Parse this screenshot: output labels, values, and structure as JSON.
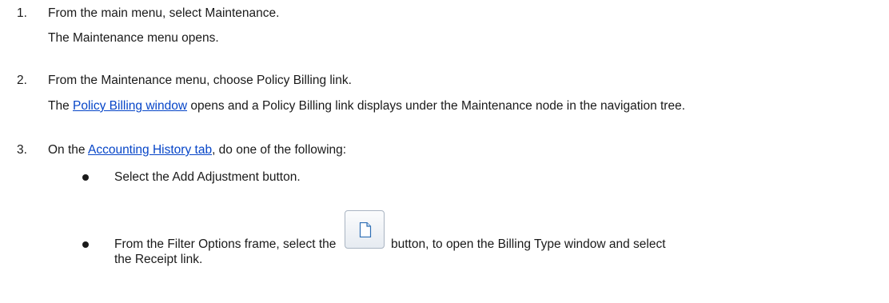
{
  "steps": [
    {
      "number": "1.",
      "lines": [
        "From the main menu, select Maintenance.",
        "The Maintenance menu opens."
      ]
    },
    {
      "number": "2.",
      "line1": "From the Maintenance menu, choose Policy Billing link.",
      "line2_link": "Policy Billing window",
      "line2_before": "The ",
      "line2_after": " opens and a Policy Billing link displays under the Maintenance node in the navigation tree."
    },
    {
      "number": "3.",
      "before": "On the ",
      "link": "Accounting History tab",
      "after": ", do one of the following:",
      "bullets": [
        "Select the Add Adjustment button.",
        "From the Filter Options frame, select the",
        "button, to open the Billing Type window and select",
        "the Receipt link."
      ]
    }
  ],
  "icons": {
    "new_button_icon": "new-document-icon"
  }
}
